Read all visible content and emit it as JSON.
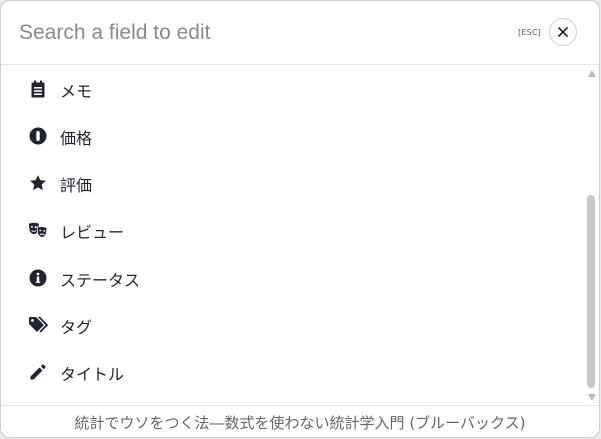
{
  "search": {
    "placeholder": "Search a field to edit",
    "value": ""
  },
  "esc_hint": "[ESC]",
  "close_icon": "close-icon",
  "fields": [
    {
      "label": "メモ",
      "icon": "notepad-icon"
    },
    {
      "label": "価格",
      "icon": "price-icon"
    },
    {
      "label": "評価",
      "icon": "star-icon"
    },
    {
      "label": "レビュー",
      "icon": "theater-masks-icon"
    },
    {
      "label": "ステータス",
      "icon": "info-icon"
    },
    {
      "label": "タグ",
      "icon": "tags-icon"
    },
    {
      "label": "タイトル",
      "icon": "pencil-icon"
    }
  ],
  "footer": {
    "item_title": "統計でウソをつく法―数式を使わない統計学入門 (ブルーバックス)"
  },
  "colors": {
    "icon": "#1f2430",
    "text": "#1f2430",
    "placeholder": "#8a8a8a"
  }
}
